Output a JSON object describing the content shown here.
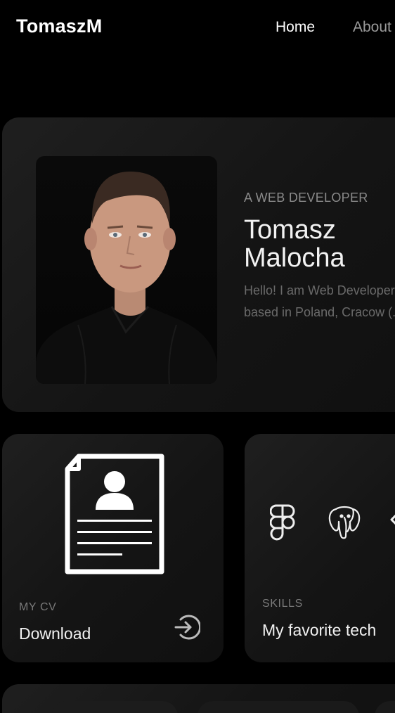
{
  "header": {
    "brand": "TomaszM",
    "nav": {
      "home": "Home",
      "about": "About"
    }
  },
  "hero": {
    "subtitle": "A WEB DEVELOPER",
    "name_line1": "Tomasz",
    "name_line2": "Malocha",
    "description": "Hello! I am Web Developer based in Poland, Cracow (...)"
  },
  "cv_card": {
    "eyebrow": "MY CV",
    "title": "Download",
    "icon": "resume-icon",
    "action_icon": "arrow-right-circle-icon"
  },
  "skills_card": {
    "eyebrow": "SKILLS",
    "title": "My favorite tech",
    "icons": [
      "figma-icon",
      "postgresql-icon",
      "edge-icon"
    ]
  },
  "colors": {
    "background": "#000000",
    "card": "#1a1a1a",
    "text_primary": "#ffffff",
    "text_muted": "#8a8a8a"
  }
}
